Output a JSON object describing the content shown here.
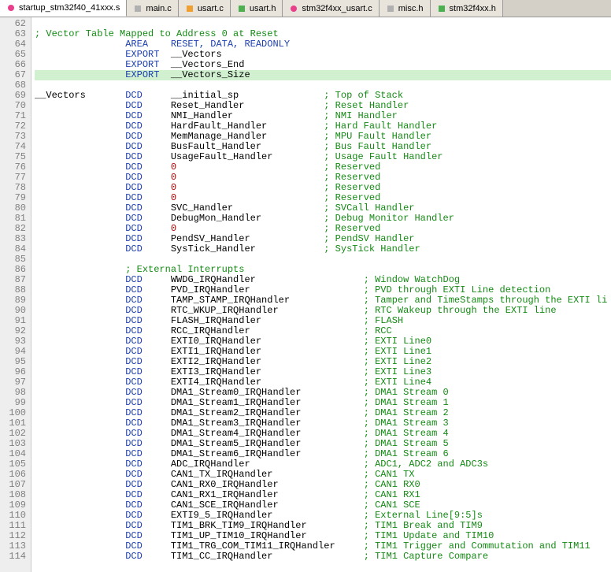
{
  "tabs": [
    {
      "label": "startup_stm32f40_41xxx.s",
      "icon": "pink",
      "active": true
    },
    {
      "label": "main.c",
      "icon": "grey",
      "active": false
    },
    {
      "label": "usart.c",
      "icon": "orange",
      "active": false
    },
    {
      "label": "usart.h",
      "icon": "green",
      "active": false
    },
    {
      "label": "stm32f4xx_usart.c",
      "icon": "pink",
      "active": false
    },
    {
      "label": "misc.h",
      "icon": "grey",
      "active": false
    },
    {
      "label": "stm32f4xx.h",
      "icon": "green",
      "active": false
    }
  ],
  "first_line_number": 62,
  "highlight_line": 67,
  "lines": [
    {
      "n": 62,
      "text": "",
      "segs": []
    },
    {
      "n": 63,
      "text": "",
      "segs": [
        {
          "t": "; Vector Table Mapped to Address 0 at Reset",
          "c": "cm"
        }
      ]
    },
    {
      "n": 64,
      "text": "",
      "segs": [
        {
          "t": "                AREA    RESET, DATA, ",
          "c": "kw"
        },
        {
          "t": "READONLY",
          "c": "kw"
        }
      ]
    },
    {
      "n": 65,
      "text": "",
      "segs": [
        {
          "t": "                EXPORT  ",
          "c": "kw"
        },
        {
          "t": "__Vectors",
          "c": "sym"
        }
      ]
    },
    {
      "n": 66,
      "text": "",
      "segs": [
        {
          "t": "                EXPORT  ",
          "c": "kw"
        },
        {
          "t": "__Vectors_End",
          "c": "sym"
        }
      ]
    },
    {
      "n": 67,
      "text": "",
      "segs": [
        {
          "t": "                EXPORT  ",
          "c": "kw"
        },
        {
          "t": "__Vectors_Size",
          "c": "sym"
        }
      ]
    },
    {
      "n": 68,
      "text": "",
      "segs": []
    },
    {
      "n": 69,
      "text": "",
      "segs": [
        {
          "t": "__Vectors       ",
          "c": "sym"
        },
        {
          "t": "DCD",
          "c": "kw"
        },
        {
          "t": "     __initial_sp               ",
          "c": "sym"
        },
        {
          "t": "; Top of Stack",
          "c": "cm"
        }
      ]
    },
    {
      "n": 70,
      "text": "",
      "segs": [
        {
          "t": "                ",
          "c": "sym"
        },
        {
          "t": "DCD",
          "c": "kw"
        },
        {
          "t": "     Reset_Handler              ",
          "c": "sym"
        },
        {
          "t": "; Reset Handler",
          "c": "cm"
        }
      ]
    },
    {
      "n": 71,
      "text": "",
      "segs": [
        {
          "t": "                ",
          "c": "sym"
        },
        {
          "t": "DCD",
          "c": "kw"
        },
        {
          "t": "     NMI_Handler                ",
          "c": "sym"
        },
        {
          "t": "; NMI Handler",
          "c": "cm"
        }
      ]
    },
    {
      "n": 72,
      "text": "",
      "segs": [
        {
          "t": "                ",
          "c": "sym"
        },
        {
          "t": "DCD",
          "c": "kw"
        },
        {
          "t": "     HardFault_Handler          ",
          "c": "sym"
        },
        {
          "t": "; Hard Fault Handler",
          "c": "cm"
        }
      ]
    },
    {
      "n": 73,
      "text": "",
      "segs": [
        {
          "t": "                ",
          "c": "sym"
        },
        {
          "t": "DCD",
          "c": "kw"
        },
        {
          "t": "     MemManage_Handler          ",
          "c": "sym"
        },
        {
          "t": "; MPU Fault Handler",
          "c": "cm"
        }
      ]
    },
    {
      "n": 74,
      "text": "",
      "segs": [
        {
          "t": "                ",
          "c": "sym"
        },
        {
          "t": "DCD",
          "c": "kw"
        },
        {
          "t": "     BusFault_Handler           ",
          "c": "sym"
        },
        {
          "t": "; Bus Fault Handler",
          "c": "cm"
        }
      ]
    },
    {
      "n": 75,
      "text": "",
      "segs": [
        {
          "t": "                ",
          "c": "sym"
        },
        {
          "t": "DCD",
          "c": "kw"
        },
        {
          "t": "     UsageFault_Handler         ",
          "c": "sym"
        },
        {
          "t": "; Usage Fault Handler",
          "c": "cm"
        }
      ]
    },
    {
      "n": 76,
      "text": "",
      "segs": [
        {
          "t": "                ",
          "c": "sym"
        },
        {
          "t": "DCD",
          "c": "kw"
        },
        {
          "t": "     ",
          "c": "sym"
        },
        {
          "t": "0",
          "c": "zero"
        },
        {
          "t": "                          ",
          "c": "sym"
        },
        {
          "t": "; Reserved",
          "c": "cm"
        }
      ]
    },
    {
      "n": 77,
      "text": "",
      "segs": [
        {
          "t": "                ",
          "c": "sym"
        },
        {
          "t": "DCD",
          "c": "kw"
        },
        {
          "t": "     ",
          "c": "sym"
        },
        {
          "t": "0",
          "c": "zero"
        },
        {
          "t": "                          ",
          "c": "sym"
        },
        {
          "t": "; Reserved",
          "c": "cm"
        }
      ]
    },
    {
      "n": 78,
      "text": "",
      "segs": [
        {
          "t": "                ",
          "c": "sym"
        },
        {
          "t": "DCD",
          "c": "kw"
        },
        {
          "t": "     ",
          "c": "sym"
        },
        {
          "t": "0",
          "c": "zero"
        },
        {
          "t": "                          ",
          "c": "sym"
        },
        {
          "t": "; Reserved",
          "c": "cm"
        }
      ]
    },
    {
      "n": 79,
      "text": "",
      "segs": [
        {
          "t": "                ",
          "c": "sym"
        },
        {
          "t": "DCD",
          "c": "kw"
        },
        {
          "t": "     ",
          "c": "sym"
        },
        {
          "t": "0",
          "c": "zero"
        },
        {
          "t": "                          ",
          "c": "sym"
        },
        {
          "t": "; Reserved",
          "c": "cm"
        }
      ]
    },
    {
      "n": 80,
      "text": "",
      "segs": [
        {
          "t": "                ",
          "c": "sym"
        },
        {
          "t": "DCD",
          "c": "kw"
        },
        {
          "t": "     SVC_Handler                ",
          "c": "sym"
        },
        {
          "t": "; SVCall Handler",
          "c": "cm"
        }
      ]
    },
    {
      "n": 81,
      "text": "",
      "segs": [
        {
          "t": "                ",
          "c": "sym"
        },
        {
          "t": "DCD",
          "c": "kw"
        },
        {
          "t": "     DebugMon_Handler           ",
          "c": "sym"
        },
        {
          "t": "; Debug Monitor Handler",
          "c": "cm"
        }
      ]
    },
    {
      "n": 82,
      "text": "",
      "segs": [
        {
          "t": "                ",
          "c": "sym"
        },
        {
          "t": "DCD",
          "c": "kw"
        },
        {
          "t": "     ",
          "c": "sym"
        },
        {
          "t": "0",
          "c": "zero"
        },
        {
          "t": "                          ",
          "c": "sym"
        },
        {
          "t": "; Reserved",
          "c": "cm"
        }
      ]
    },
    {
      "n": 83,
      "text": "",
      "segs": [
        {
          "t": "                ",
          "c": "sym"
        },
        {
          "t": "DCD",
          "c": "kw"
        },
        {
          "t": "     PendSV_Handler             ",
          "c": "sym"
        },
        {
          "t": "; PendSV Handler",
          "c": "cm"
        }
      ]
    },
    {
      "n": 84,
      "text": "",
      "segs": [
        {
          "t": "                ",
          "c": "sym"
        },
        {
          "t": "DCD",
          "c": "kw"
        },
        {
          "t": "     SysTick_Handler            ",
          "c": "sym"
        },
        {
          "t": "; SysTick Handler",
          "c": "cm"
        }
      ]
    },
    {
      "n": 85,
      "text": "",
      "segs": []
    },
    {
      "n": 86,
      "text": "",
      "segs": [
        {
          "t": "                ",
          "c": "sym"
        },
        {
          "t": "; External Interrupts",
          "c": "cm"
        }
      ]
    },
    {
      "n": 87,
      "text": "",
      "segs": [
        {
          "t": "                ",
          "c": "sym"
        },
        {
          "t": "DCD",
          "c": "kw"
        },
        {
          "t": "     WWDG_IRQHandler                   ",
          "c": "sym"
        },
        {
          "t": "; Window WatchDog",
          "c": "cm"
        }
      ]
    },
    {
      "n": 88,
      "text": "",
      "segs": [
        {
          "t": "                ",
          "c": "sym"
        },
        {
          "t": "DCD",
          "c": "kw"
        },
        {
          "t": "     PVD_IRQHandler                    ",
          "c": "sym"
        },
        {
          "t": "; PVD through EXTI Line detection",
          "c": "cm"
        }
      ]
    },
    {
      "n": 89,
      "text": "",
      "segs": [
        {
          "t": "                ",
          "c": "sym"
        },
        {
          "t": "DCD",
          "c": "kw"
        },
        {
          "t": "     TAMP_STAMP_IRQHandler             ",
          "c": "sym"
        },
        {
          "t": "; Tamper and TimeStamps through the EXTI li",
          "c": "cm"
        }
      ]
    },
    {
      "n": 90,
      "text": "",
      "segs": [
        {
          "t": "                ",
          "c": "sym"
        },
        {
          "t": "DCD",
          "c": "kw"
        },
        {
          "t": "     RTC_WKUP_IRQHandler               ",
          "c": "sym"
        },
        {
          "t": "; RTC Wakeup through the EXTI line",
          "c": "cm"
        }
      ]
    },
    {
      "n": 91,
      "text": "",
      "segs": [
        {
          "t": "                ",
          "c": "sym"
        },
        {
          "t": "DCD",
          "c": "kw"
        },
        {
          "t": "     FLASH_IRQHandler                  ",
          "c": "sym"
        },
        {
          "t": "; FLASH",
          "c": "cm"
        }
      ]
    },
    {
      "n": 92,
      "text": "",
      "segs": [
        {
          "t": "                ",
          "c": "sym"
        },
        {
          "t": "DCD",
          "c": "kw"
        },
        {
          "t": "     RCC_IRQHandler                    ",
          "c": "sym"
        },
        {
          "t": "; RCC",
          "c": "cm"
        }
      ]
    },
    {
      "n": 93,
      "text": "",
      "segs": [
        {
          "t": "                ",
          "c": "sym"
        },
        {
          "t": "DCD",
          "c": "kw"
        },
        {
          "t": "     EXTI0_IRQHandler                  ",
          "c": "sym"
        },
        {
          "t": "; EXTI Line0",
          "c": "cm"
        }
      ]
    },
    {
      "n": 94,
      "text": "",
      "segs": [
        {
          "t": "                ",
          "c": "sym"
        },
        {
          "t": "DCD",
          "c": "kw"
        },
        {
          "t": "     EXTI1_IRQHandler                  ",
          "c": "sym"
        },
        {
          "t": "; EXTI Line1",
          "c": "cm"
        }
      ]
    },
    {
      "n": 95,
      "text": "",
      "segs": [
        {
          "t": "                ",
          "c": "sym"
        },
        {
          "t": "DCD",
          "c": "kw"
        },
        {
          "t": "     EXTI2_IRQHandler                  ",
          "c": "sym"
        },
        {
          "t": "; EXTI Line2",
          "c": "cm"
        }
      ]
    },
    {
      "n": 96,
      "text": "",
      "segs": [
        {
          "t": "                ",
          "c": "sym"
        },
        {
          "t": "DCD",
          "c": "kw"
        },
        {
          "t": "     EXTI3_IRQHandler                  ",
          "c": "sym"
        },
        {
          "t": "; EXTI Line3",
          "c": "cm"
        }
      ]
    },
    {
      "n": 97,
      "text": "",
      "segs": [
        {
          "t": "                ",
          "c": "sym"
        },
        {
          "t": "DCD",
          "c": "kw"
        },
        {
          "t": "     EXTI4_IRQHandler                  ",
          "c": "sym"
        },
        {
          "t": "; EXTI Line4",
          "c": "cm"
        }
      ]
    },
    {
      "n": 98,
      "text": "",
      "segs": [
        {
          "t": "                ",
          "c": "sym"
        },
        {
          "t": "DCD",
          "c": "kw"
        },
        {
          "t": "     DMA1_Stream0_IRQHandler           ",
          "c": "sym"
        },
        {
          "t": "; DMA1 Stream 0",
          "c": "cm"
        }
      ]
    },
    {
      "n": 99,
      "text": "",
      "segs": [
        {
          "t": "                ",
          "c": "sym"
        },
        {
          "t": "DCD",
          "c": "kw"
        },
        {
          "t": "     DMA1_Stream1_IRQHandler           ",
          "c": "sym"
        },
        {
          "t": "; DMA1 Stream 1",
          "c": "cm"
        }
      ]
    },
    {
      "n": 100,
      "text": "",
      "segs": [
        {
          "t": "                ",
          "c": "sym"
        },
        {
          "t": "DCD",
          "c": "kw"
        },
        {
          "t": "     DMA1_Stream2_IRQHandler           ",
          "c": "sym"
        },
        {
          "t": "; DMA1 Stream 2",
          "c": "cm"
        }
      ]
    },
    {
      "n": 101,
      "text": "",
      "segs": [
        {
          "t": "                ",
          "c": "sym"
        },
        {
          "t": "DCD",
          "c": "kw"
        },
        {
          "t": "     DMA1_Stream3_IRQHandler           ",
          "c": "sym"
        },
        {
          "t": "; DMA1 Stream 3",
          "c": "cm"
        }
      ]
    },
    {
      "n": 102,
      "text": "",
      "segs": [
        {
          "t": "                ",
          "c": "sym"
        },
        {
          "t": "DCD",
          "c": "kw"
        },
        {
          "t": "     DMA1_Stream4_IRQHandler           ",
          "c": "sym"
        },
        {
          "t": "; DMA1 Stream 4",
          "c": "cm"
        }
      ]
    },
    {
      "n": 103,
      "text": "",
      "segs": [
        {
          "t": "                ",
          "c": "sym"
        },
        {
          "t": "DCD",
          "c": "kw"
        },
        {
          "t": "     DMA1_Stream5_IRQHandler           ",
          "c": "sym"
        },
        {
          "t": "; DMA1 Stream 5",
          "c": "cm"
        }
      ]
    },
    {
      "n": 104,
      "text": "",
      "segs": [
        {
          "t": "                ",
          "c": "sym"
        },
        {
          "t": "DCD",
          "c": "kw"
        },
        {
          "t": "     DMA1_Stream6_IRQHandler           ",
          "c": "sym"
        },
        {
          "t": "; DMA1 Stream 6",
          "c": "cm"
        }
      ]
    },
    {
      "n": 105,
      "text": "",
      "segs": [
        {
          "t": "                ",
          "c": "sym"
        },
        {
          "t": "DCD",
          "c": "kw"
        },
        {
          "t": "     ADC_IRQHandler                    ",
          "c": "sym"
        },
        {
          "t": "; ADC1, ADC2 and ADC3s",
          "c": "cm"
        }
      ]
    },
    {
      "n": 106,
      "text": "",
      "segs": [
        {
          "t": "                ",
          "c": "sym"
        },
        {
          "t": "DCD",
          "c": "kw"
        },
        {
          "t": "     CAN1_TX_IRQHandler                ",
          "c": "sym"
        },
        {
          "t": "; CAN1 TX",
          "c": "cm"
        }
      ]
    },
    {
      "n": 107,
      "text": "",
      "segs": [
        {
          "t": "                ",
          "c": "sym"
        },
        {
          "t": "DCD",
          "c": "kw"
        },
        {
          "t": "     CAN1_RX0_IRQHandler               ",
          "c": "sym"
        },
        {
          "t": "; CAN1 RX0",
          "c": "cm"
        }
      ]
    },
    {
      "n": 108,
      "text": "",
      "segs": [
        {
          "t": "                ",
          "c": "sym"
        },
        {
          "t": "DCD",
          "c": "kw"
        },
        {
          "t": "     CAN1_RX1_IRQHandler               ",
          "c": "sym"
        },
        {
          "t": "; CAN1 RX1",
          "c": "cm"
        }
      ]
    },
    {
      "n": 109,
      "text": "",
      "segs": [
        {
          "t": "                ",
          "c": "sym"
        },
        {
          "t": "DCD",
          "c": "kw"
        },
        {
          "t": "     CAN1_SCE_IRQHandler               ",
          "c": "sym"
        },
        {
          "t": "; CAN1 SCE",
          "c": "cm"
        }
      ]
    },
    {
      "n": 110,
      "text": "",
      "segs": [
        {
          "t": "                ",
          "c": "sym"
        },
        {
          "t": "DCD",
          "c": "kw"
        },
        {
          "t": "     EXTI9_5_IRQHandler                ",
          "c": "sym"
        },
        {
          "t": "; External Line[9:5]s",
          "c": "cm"
        }
      ]
    },
    {
      "n": 111,
      "text": "",
      "segs": [
        {
          "t": "                ",
          "c": "sym"
        },
        {
          "t": "DCD",
          "c": "kw"
        },
        {
          "t": "     TIM1_BRK_TIM9_IRQHandler          ",
          "c": "sym"
        },
        {
          "t": "; TIM1 Break and TIM9",
          "c": "cm"
        }
      ]
    },
    {
      "n": 112,
      "text": "",
      "segs": [
        {
          "t": "                ",
          "c": "sym"
        },
        {
          "t": "DCD",
          "c": "kw"
        },
        {
          "t": "     TIM1_UP_TIM10_IRQHandler          ",
          "c": "sym"
        },
        {
          "t": "; TIM1 Update and TIM10",
          "c": "cm"
        }
      ]
    },
    {
      "n": 113,
      "text": "",
      "segs": [
        {
          "t": "                ",
          "c": "sym"
        },
        {
          "t": "DCD",
          "c": "kw"
        },
        {
          "t": "     TIM1_TRG_COM_TIM11_IRQHandler     ",
          "c": "sym"
        },
        {
          "t": "; TIM1 Trigger and Commutation and TIM11",
          "c": "cm"
        }
      ]
    },
    {
      "n": 114,
      "text": "",
      "segs": [
        {
          "t": "                ",
          "c": "sym"
        },
        {
          "t": "DCD",
          "c": "kw"
        },
        {
          "t": "     TIM1_CC_IRQHandler                ",
          "c": "sym"
        },
        {
          "t": "; TIM1 Capture Compare",
          "c": "cm"
        }
      ]
    }
  ]
}
